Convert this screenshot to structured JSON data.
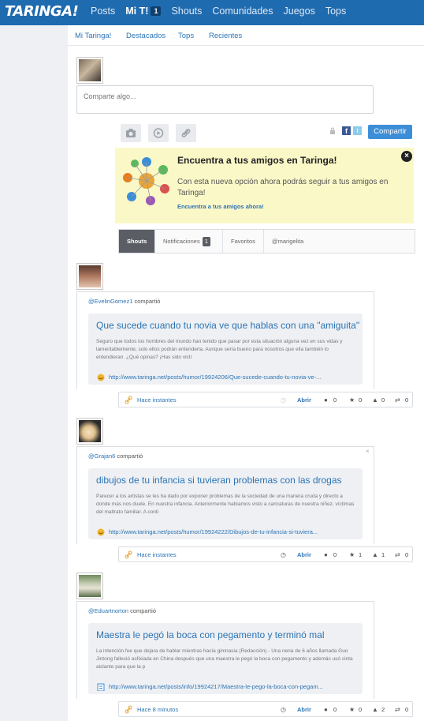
{
  "brand": {
    "logo": "TARINGA!",
    "accent": "#1f6bb0",
    "link": "#2c74b5"
  },
  "nav": [
    {
      "label": "Posts"
    },
    {
      "label": "Mi T!",
      "badge": "1",
      "active": true
    },
    {
      "label": "Shouts"
    },
    {
      "label": "Comunidades"
    },
    {
      "label": "Juegos"
    },
    {
      "label": "Tops"
    }
  ],
  "subnav": [
    "Mi Taringa!",
    "Destacados",
    "Tops",
    "Recientes"
  ],
  "composer": {
    "placeholder": "Comparte algo...",
    "share_label": "Compartir",
    "tools": [
      "camera-icon",
      "play-icon",
      "link-icon"
    ]
  },
  "promo": {
    "title": "Encuentra a tus amigos en Taringa!",
    "body": "Con esta nueva opción ahora podrás seguir a tus amigos en Taringa!",
    "link": "Encuentra a tus amigos ahora!"
  },
  "tabs": [
    {
      "label": "Shouts",
      "active": true
    },
    {
      "label": "Notificaciones",
      "badge": "1"
    },
    {
      "label": "Favoritos"
    },
    {
      "label": "@marigelita"
    }
  ],
  "posts": [
    {
      "author": "@EvelinGomez1",
      "action": " compartió",
      "title": "Que sucede cuando tu novia ve que hablas con una \"amiguita\"",
      "desc": "Seguro que todos los hombres del mundo han tenido que pasar por esta situación alguna vez en sus vidas y lamentablemente, solo ellos podrán entenderla. Aunque sería bueno para nosotros que ella también lo entendieran. ¿Qué opinas? ¡Has sido victi",
      "url": "http://www.taringa.net/posts/humor/19924206/Que-sucede-cuando-tu-novia-ve-...",
      "time": "Hace instantes",
      "open": "Abrir",
      "comments": "0",
      "favs": "0",
      "points": "0",
      "shares": "0"
    },
    {
      "author": "@Grajan6",
      "action": " compartió",
      "title": "dibujos de tu infancia si tuvieran problemas con las drogas",
      "desc": "Parecer a los artistas se les ha dado por exponer problemas de la sociedad de una manera cruda y directo a donde más nos duele. En nuestra infancia. Anteriormente habíamos visto a caricaturas de nuestra niñez, víctimas del maltrato familiar. A conti",
      "url": "http://www.taringa.net/posts/humor/19924222/Dibujos-de-tu-infancia-si-tuviera...",
      "time": "Hace instantes",
      "open": "Abrir",
      "comments": "0",
      "favs": "1",
      "points": "1",
      "shares": "0"
    },
    {
      "author": "@Eduartnorton",
      "action": " compartió",
      "title": "Maestra le pegó la boca con pegamento y terminó mal",
      "desc": "La intención fue que dejara de hablar mientras hacía gimnasia (Redacción) - Una nena de 6 años llamada Guo Jintong falleció asfixiada en China después que una maestra le pegó la boca con pegamento y además usó cinta aislante para que la p",
      "url": "http://www.taringa.net/posts/info/19924217/Maestra-le-pego-la-boca-con-pegam...",
      "time": "Hace 8 minutos",
      "open": "Abrir",
      "comments": "0",
      "favs": "0",
      "points": "2",
      "shares": "0"
    }
  ]
}
